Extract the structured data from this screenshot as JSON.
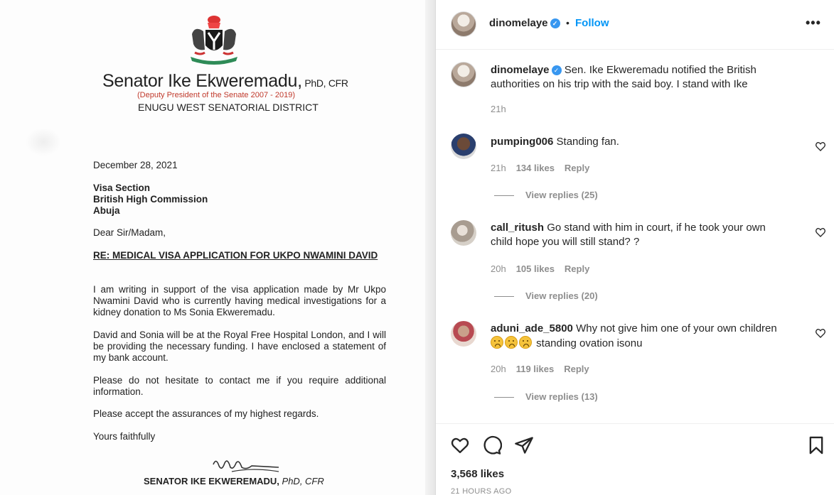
{
  "letter": {
    "senator_name": "Senator Ike Ekweremadu,",
    "senator_title": " PhD, CFR",
    "role": "(Deputy President of the Senate 2007 - 2019)",
    "district": "ENUGU WEST SENATORIAL DISTRICT",
    "date": "December 28, 2021",
    "address_line1": "Visa Section",
    "address_line2": "British High Commission",
    "address_line3": "Abuja",
    "salutation": "Dear Sir/Madam,",
    "subject": "RE: MEDICAL VISA APPLICATION FOR UKPO NWAMINI DAVID",
    "para1": "I am writing in support of the visa application made by Mr Ukpo Nwamini David who is currently having medical investigations for a kidney donation to Ms Sonia Ekweremadu.",
    "para2": "David and Sonia will be at the Royal Free Hospital London, and I will be providing the necessary funding. I have enclosed a statement of my bank account.",
    "para3": "Please do not hesitate to contact me if you require additional information.",
    "para4": "Please accept the assurances of my highest regards.",
    "closing": "Yours faithfully",
    "signer_name": "SENATOR IKE EKWEREMADU,",
    "signer_title": " PhD, CFR"
  },
  "post": {
    "username": "dinomelaye",
    "dot": "•",
    "follow_label": "Follow",
    "more_label": "•••",
    "caption_user": "dinomelaye",
    "caption_text": " Sen. Ike Ekweremadu notified the British authorities on his trip with the said boy. I stand with Ike",
    "caption_time": "21h"
  },
  "comments": [
    {
      "user": "pumping006",
      "text": " Standing fan.",
      "time": "21h",
      "likes": "134 likes",
      "reply_label": "Reply",
      "view_replies": "View replies (25)"
    },
    {
      "user": "call_ritush",
      "text": " Go stand with him in court, if he took your own child hope you will still stand? ?",
      "time": "20h",
      "likes": "105 likes",
      "reply_label": "Reply",
      "view_replies": "View replies (20)"
    },
    {
      "user": "aduni_ade_5800",
      "text": " Why not give him one of your own children",
      "text_after": " standing ovation isonu",
      "time": "20h",
      "likes": "119 likes",
      "reply_label": "Reply",
      "view_replies": "View replies (13)"
    }
  ],
  "footer": {
    "likes_count": "3,568 likes",
    "time_ago": "21 HOURS AGO"
  },
  "icons": {
    "verified": "verified-badge-icon",
    "like": "heart-icon",
    "comment": "comment-bubble-icon",
    "share": "paper-plane-icon",
    "save": "bookmark-icon",
    "emoji": "frowning-face-emoji"
  },
  "colors": {
    "accent": "#0095f6",
    "muted": "#8e8e8e",
    "text": "#262626",
    "role_red": "#c0392b"
  }
}
